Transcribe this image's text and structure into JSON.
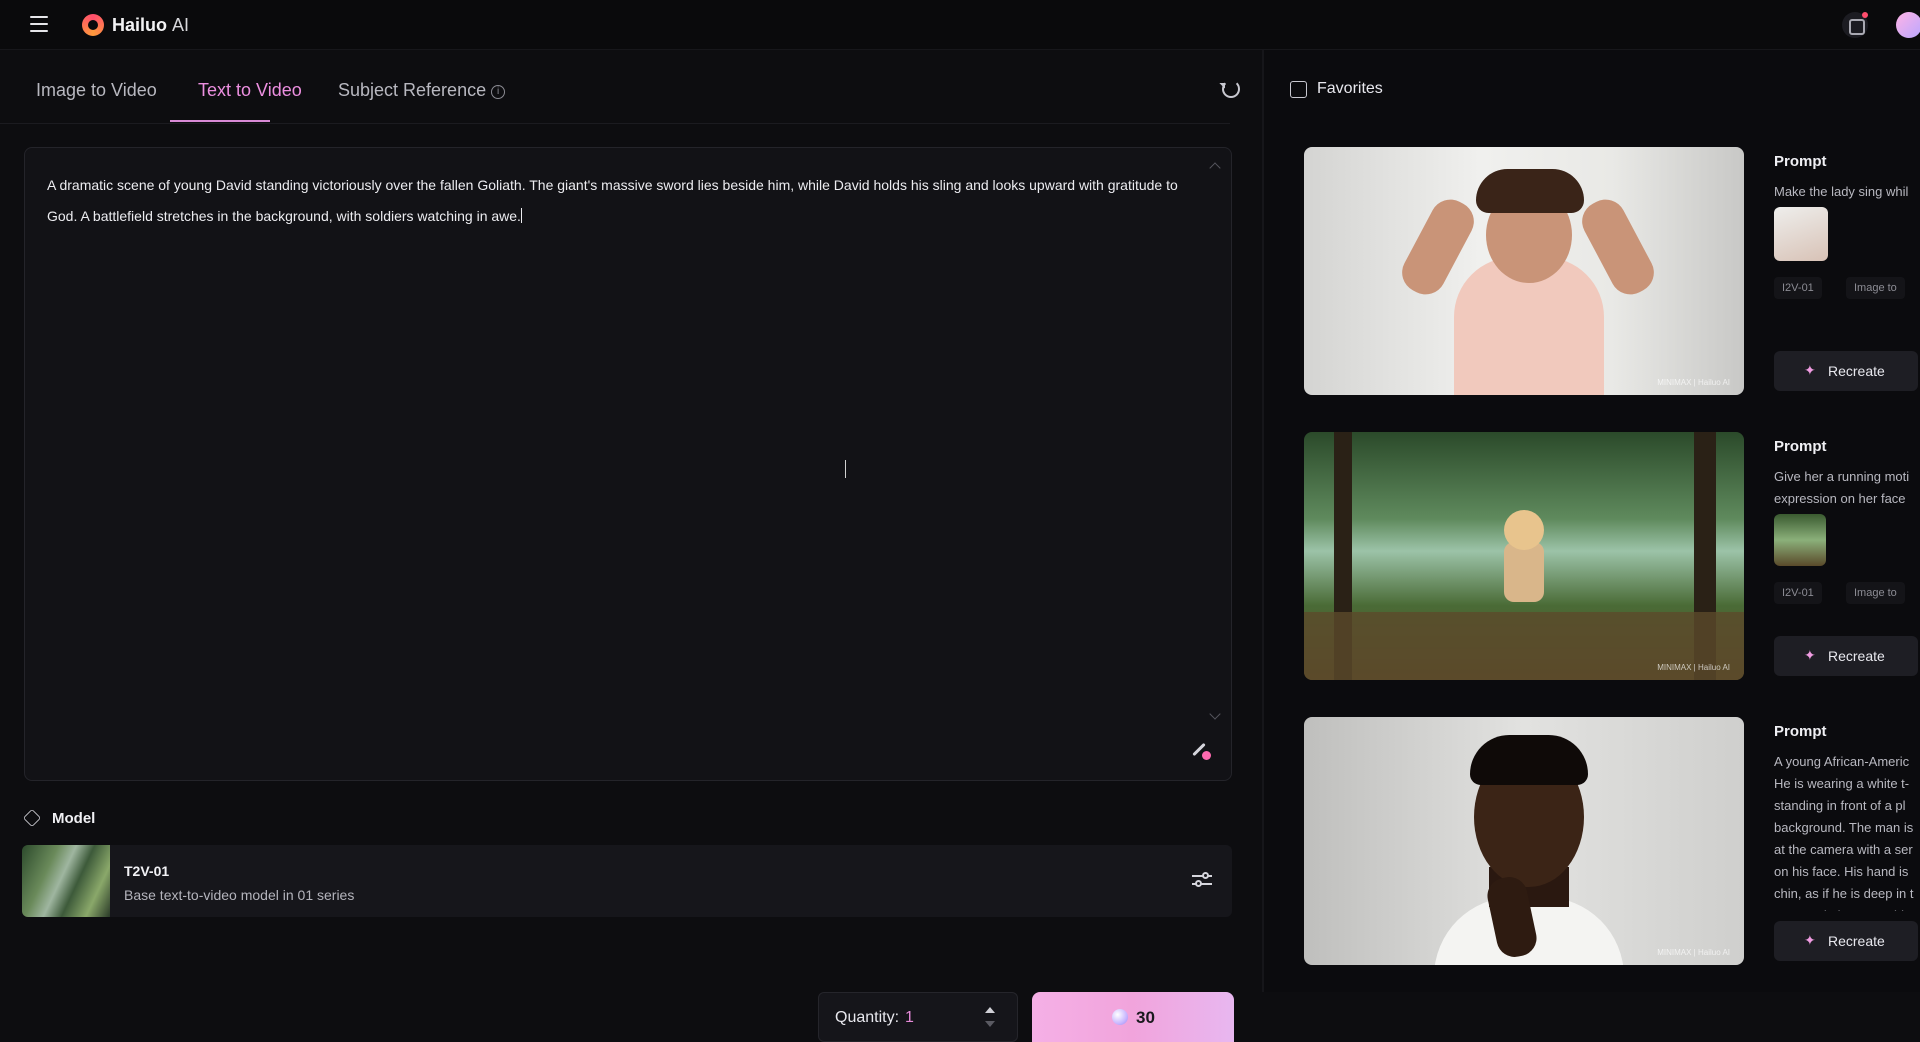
{
  "app": {
    "name": "Hailuo",
    "name_suffix": "AI"
  },
  "tabs": [
    {
      "label": "Image to Video",
      "active": false
    },
    {
      "label": "Text to Video",
      "active": true
    },
    {
      "label": "Subject Reference",
      "active": false
    }
  ],
  "prompt": {
    "text": "A dramatic scene of young David standing victoriously over the fallen Goliath. The giant's massive sword lies beside him, while David holds his sling and looks upward with gratitude to God. A battlefield stretches in the background, with soldiers watching in awe."
  },
  "model": {
    "section_label": "Model",
    "name": "T2V-01",
    "description": "Base text-to-video model in 01 series"
  },
  "footer": {
    "quantity_label": "Quantity:",
    "quantity_value": "1",
    "generate_cost": "30"
  },
  "favorites": {
    "label": "Favorites"
  },
  "gallery": [
    {
      "prompt_title": "Prompt",
      "prompt_text": "Make the lady sing whil",
      "tags": [
        "I2V-01",
        "Image to"
      ],
      "recreate_label": "Recreate",
      "watermark": "MINIMAX | Hailuo AI"
    },
    {
      "prompt_title": "Prompt",
      "prompt_text": "Give her a running moti\nexpression on her face",
      "tags": [
        "I2V-01",
        "Image to"
      ],
      "recreate_label": "Recreate",
      "watermark": "MINIMAX | Hailuo AI"
    },
    {
      "prompt_title": "Prompt",
      "prompt_text": "A young African-Americ\nHe is wearing a white t-\nstanding in front of a pl\nbackground. The man is\nat the camera with a ser\non his face. His hand is\nchin, as if he is deep in t\ncontemplating somethi",
      "tags": [],
      "recreate_label": "Recreate",
      "watermark": "MINIMAX | Hailuo AI"
    }
  ],
  "colors": {
    "accent": "#ec8fe0",
    "background": "#0d0d10",
    "panel": "#121216"
  }
}
